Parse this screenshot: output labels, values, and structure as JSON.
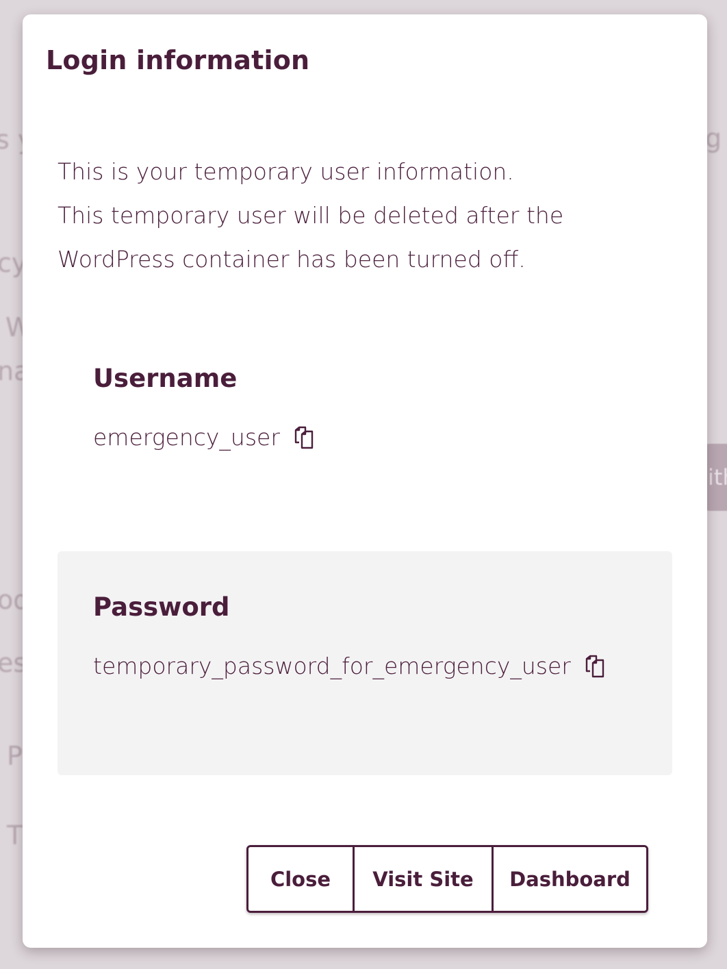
{
  "background": {
    "fragments": [
      "s y",
      "cy",
      "W",
      "na",
      "od",
      "es",
      "P",
      "T",
      "g"
    ],
    "button_fragment": "ith"
  },
  "modal": {
    "title": "Login information",
    "intro_lines": [
      "This is your temporary user information.",
      "This temporary user will be deleted after the",
      "WordPress container has been turned off."
    ],
    "username": {
      "label": "Username",
      "value": "emergency_user",
      "icon": "copy-icon"
    },
    "password": {
      "label": "Password",
      "value": "temporary_password_for_emergency_user",
      "icon": "copy-icon"
    },
    "buttons": {
      "close": "Close",
      "visit_site": "Visit Site",
      "dashboard": "Dashboard"
    }
  },
  "colors": {
    "text": "#4a1e3b",
    "password_panel": "#f4f3f4",
    "backdrop": "#ddd6da"
  }
}
